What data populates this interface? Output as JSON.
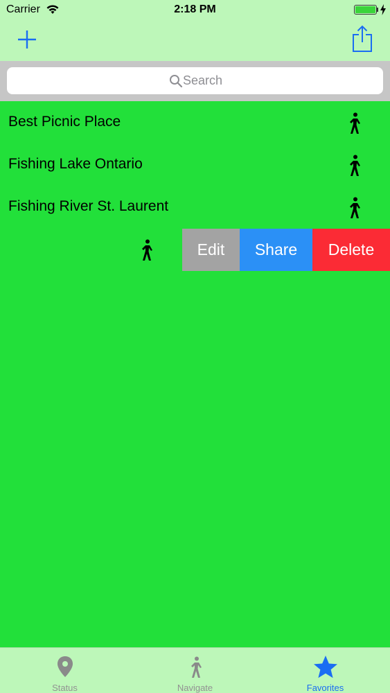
{
  "status_bar": {
    "carrier": "Carrier",
    "time": "2:18 PM",
    "icons": [
      "wifi-icon",
      "battery-icon",
      "charging-bolt-icon"
    ]
  },
  "nav_bar": {
    "left_icon": "plus-icon",
    "right_icon": "share-icon"
  },
  "search": {
    "placeholder": "Search",
    "value": ""
  },
  "list": {
    "items": [
      {
        "label": "Best Picnic Place",
        "icon": "walking-person-icon"
      },
      {
        "label": "Fishing Lake Ontario",
        "icon": "walking-person-icon"
      },
      {
        "label": "Fishing River St. Laurent",
        "icon": "walking-person-icon"
      }
    ],
    "swiped_item": {
      "icon": "walking-person-icon",
      "actions": {
        "edit": "Edit",
        "share": "Share",
        "delete": "Delete"
      }
    }
  },
  "tabs": [
    {
      "label": "Status",
      "icon": "map-pin-icon",
      "active": false
    },
    {
      "label": "Navigate",
      "icon": "walking-person-icon",
      "active": false
    },
    {
      "label": "Favorites",
      "icon": "star-icon",
      "active": true
    }
  ],
  "colors": {
    "background": "#22e03a",
    "bars": "#bdf7b9",
    "accent": "#1a6df2",
    "edit": "#a3a3a3",
    "share": "#2b90f6",
    "delete": "#fb2b35"
  }
}
